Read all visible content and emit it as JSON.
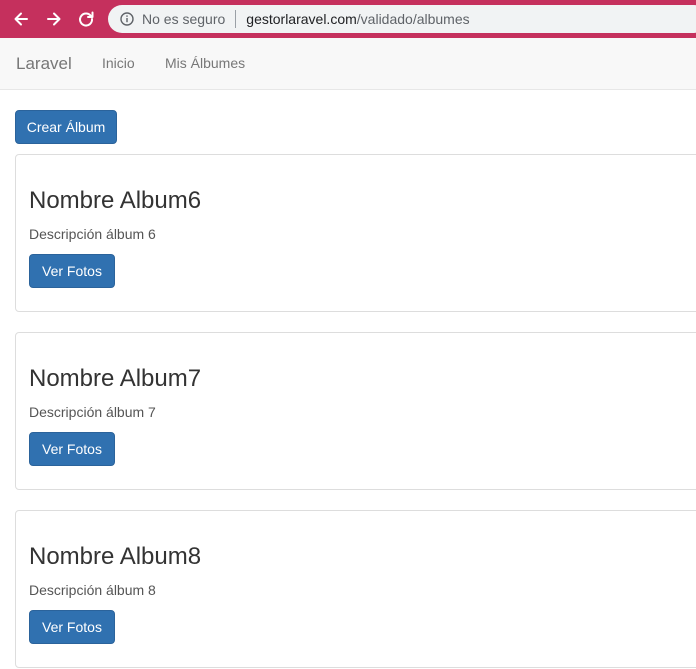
{
  "browser": {
    "security_label": "No es seguro",
    "url_host": "gestorlaravel.com",
    "url_path": "/validado/albumes"
  },
  "navbar": {
    "brand": "Laravel",
    "links": [
      "Inicio",
      "Mis Álbumes"
    ]
  },
  "actions": {
    "create_album": "Crear Álbum"
  },
  "albums": [
    {
      "title": "Nombre Album6",
      "description": "Descripción álbum 6",
      "button": "Ver Fotos"
    },
    {
      "title": "Nombre Album7",
      "description": "Descripción álbum 7",
      "button": "Ver Fotos"
    },
    {
      "title": "Nombre Album8",
      "description": "Descripción álbum 8",
      "button": "Ver Fotos"
    }
  ],
  "colors": {
    "browser_bar": "#c5305d",
    "primary_button": "#3071b0",
    "navbar_bg": "#f8f8f8"
  }
}
